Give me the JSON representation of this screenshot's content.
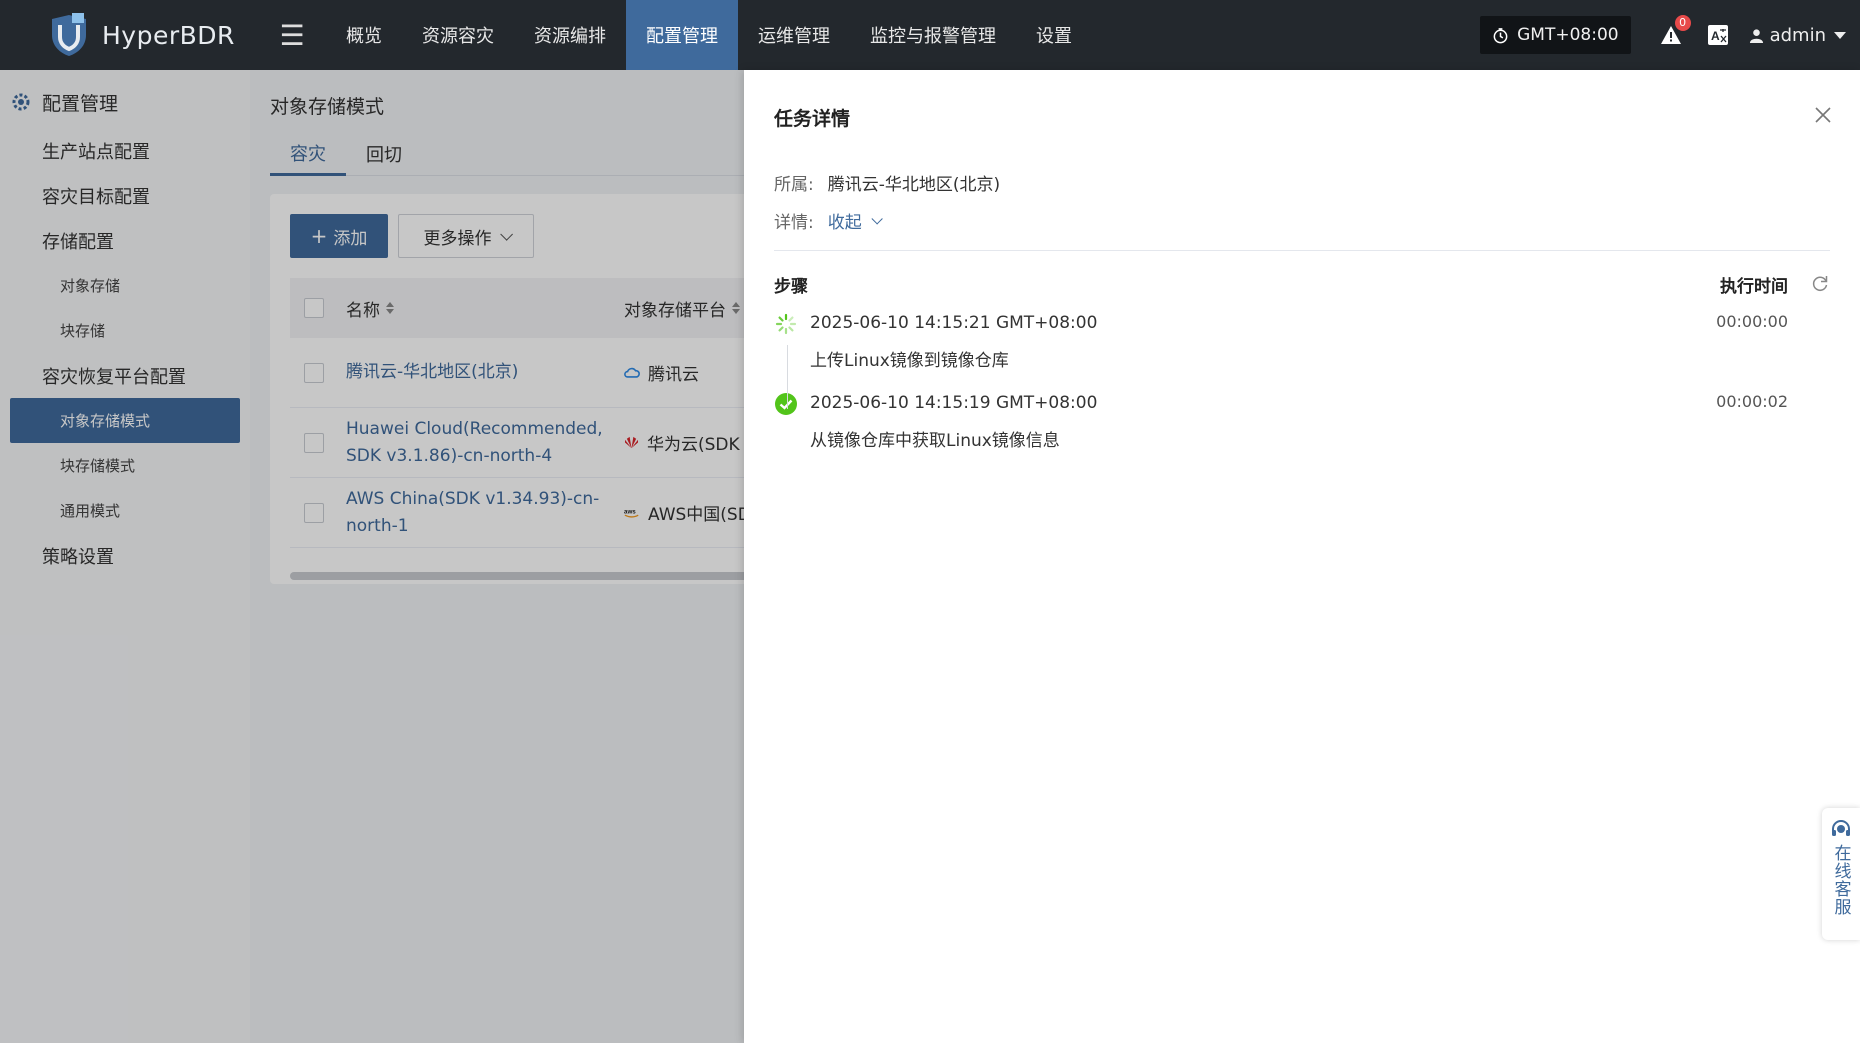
{
  "app": {
    "name": "HyperBDR"
  },
  "nav": [
    {
      "label": "概览",
      "active": false
    },
    {
      "label": "资源容灾",
      "active": false
    },
    {
      "label": "资源编排",
      "active": false
    },
    {
      "label": "配置管理",
      "active": true
    },
    {
      "label": "运维管理",
      "active": false
    },
    {
      "label": "监控与报警管理",
      "active": false
    },
    {
      "label": "设置",
      "active": false
    }
  ],
  "topbar": {
    "timezone": "GMT+08:00",
    "alert_count": "0",
    "user": "admin"
  },
  "sidebar": {
    "header": "配置管理",
    "items": [
      {
        "label": "生产站点配置",
        "level": 1
      },
      {
        "label": "容灾目标配置",
        "level": 1
      },
      {
        "label": "存储配置",
        "level": 1
      },
      {
        "label": "对象存储",
        "level": 2
      },
      {
        "label": "块存储",
        "level": 2
      },
      {
        "label": "容灾恢复平台配置",
        "level": 1
      },
      {
        "label": "对象存储模式",
        "level": 2,
        "active": true
      },
      {
        "label": "块存储模式",
        "level": 2
      },
      {
        "label": "通用模式",
        "level": 2
      },
      {
        "label": "策略设置",
        "level": 1
      }
    ]
  },
  "main": {
    "title": "对象存储模式",
    "tabs": [
      {
        "label": "容灾",
        "active": true
      },
      {
        "label": "回切",
        "active": false
      }
    ],
    "add_label": "添加",
    "more_label": "更多操作",
    "columns": {
      "name": "名称",
      "platform": "对象存储平台"
    },
    "rows": [
      {
        "name": "腾讯云-华北地区(北京)",
        "platform": "腾讯云",
        "platform_icon": "tencent-cloud-icon"
      },
      {
        "name": "Huawei Cloud(Recommended, SDK v3.1.86)-cn-north-4",
        "platform": "华为云(SDK",
        "platform_icon": "huawei-cloud-icon"
      },
      {
        "name": "AWS China(SDK v1.34.93)-cn-north-1",
        "platform": "AWS中国(SD",
        "platform_icon": "aws-icon"
      }
    ]
  },
  "drawer": {
    "title": "任务详情",
    "owner_label": "所属:",
    "owner_value": "腾讯云-华北地区(北京)",
    "detail_label": "详情:",
    "detail_toggle": "收起",
    "steps_label": "步骤",
    "exec_time_label": "执行时间",
    "steps": [
      {
        "time": "2025-06-10 14:15:21 GMT+08:00",
        "desc": "上传Linux镜像到镜像仓库",
        "duration": "00:00:00",
        "status": "running"
      },
      {
        "time": "2025-06-10 14:15:19 GMT+08:00",
        "desc": "从镜像仓库中获取Linux镜像信息",
        "duration": "00:00:02",
        "status": "success"
      }
    ]
  },
  "help": {
    "label": "在线客服"
  },
  "colors": {
    "topbar": "#23282d",
    "accent": "#3f6a9c",
    "success": "#52c41a"
  }
}
